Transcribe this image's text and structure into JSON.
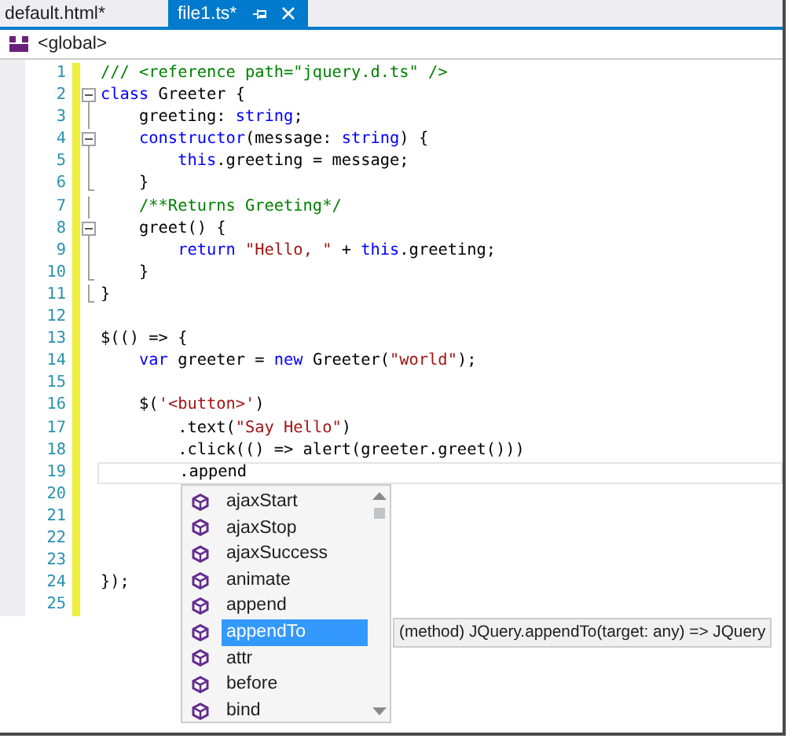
{
  "tabs": [
    {
      "label": "default.html*",
      "selected": false,
      "pinned": false
    },
    {
      "label": "file1.ts*",
      "selected": true,
      "pinned": true
    }
  ],
  "navigation_bar": {
    "scope": "<global>"
  },
  "editor": {
    "lines": [
      {
        "number": "1",
        "changed": true,
        "kind": "plain",
        "current": false,
        "tokens": [
          {
            "kind": "comment",
            "text": "/// <reference path=\"jquery.d.ts\" />"
          }
        ]
      },
      {
        "number": "2",
        "changed": true,
        "kind": "fold-start",
        "current": false,
        "tokens": [
          {
            "kind": "keyword",
            "text": "class"
          },
          {
            "kind": "plain",
            "text": " Greeter {"
          }
        ]
      },
      {
        "number": "3",
        "changed": true,
        "kind": "fold-inner",
        "current": false,
        "tokens": [
          {
            "kind": "plain",
            "text": "    greeting: "
          },
          {
            "kind": "keyword",
            "text": "string"
          },
          {
            "kind": "plain",
            "text": ";"
          }
        ]
      },
      {
        "number": "4",
        "changed": true,
        "kind": "fold-start",
        "current": false,
        "tokens": [
          {
            "kind": "keyword",
            "text": "    constructor"
          },
          {
            "kind": "plain",
            "text": "(message: "
          },
          {
            "kind": "keyword",
            "text": "string"
          },
          {
            "kind": "plain",
            "text": ") {"
          }
        ]
      },
      {
        "number": "5",
        "changed": true,
        "kind": "fold-inner",
        "current": false,
        "tokens": [
          {
            "kind": "keyword",
            "text": "        this"
          },
          {
            "kind": "plain",
            "text": ".greeting = message;"
          }
        ]
      },
      {
        "number": "6",
        "changed": true,
        "kind": "fold-end",
        "current": false,
        "tokens": [
          {
            "kind": "plain",
            "text": "    }"
          }
        ]
      },
      {
        "number": "7",
        "changed": true,
        "kind": "fold-inner",
        "current": false,
        "tokens": [
          {
            "kind": "comment",
            "text": "    /**Returns Greeting*/"
          }
        ]
      },
      {
        "number": "8",
        "changed": true,
        "kind": "fold-start",
        "current": false,
        "tokens": [
          {
            "kind": "plain",
            "text": "    greet() {"
          }
        ]
      },
      {
        "number": "9",
        "changed": true,
        "kind": "fold-inner",
        "current": false,
        "tokens": [
          {
            "kind": "keyword",
            "text": "        return "
          },
          {
            "kind": "string",
            "text": "\"Hello, \""
          },
          {
            "kind": "plain",
            "text": " + "
          },
          {
            "kind": "keyword",
            "text": "this"
          },
          {
            "kind": "plain",
            "text": ".greeting;"
          }
        ]
      },
      {
        "number": "10",
        "changed": true,
        "kind": "fold-end",
        "current": false,
        "tokens": [
          {
            "kind": "plain",
            "text": "    }"
          }
        ]
      },
      {
        "number": "11",
        "changed": true,
        "kind": "fold-end",
        "current": false,
        "tokens": [
          {
            "kind": "plain",
            "text": "}"
          }
        ]
      },
      {
        "number": "12",
        "changed": true,
        "kind": "plain",
        "current": false
      },
      {
        "number": "13",
        "changed": true,
        "kind": "plain",
        "current": false,
        "tokens": [
          {
            "kind": "plain",
            "text": "$(() => {"
          }
        ]
      },
      {
        "number": "14",
        "changed": true,
        "kind": "plain",
        "current": false,
        "tokens": [
          {
            "kind": "keyword",
            "text": "    var"
          },
          {
            "kind": "plain",
            "text": " greeter = "
          },
          {
            "kind": "keyword",
            "text": "new"
          },
          {
            "kind": "plain",
            "text": " Greeter("
          },
          {
            "kind": "string",
            "text": "\"world\""
          },
          {
            "kind": "plain",
            "text": ");"
          }
        ]
      },
      {
        "number": "15",
        "changed": true,
        "kind": "plain",
        "current": false
      },
      {
        "number": "16",
        "changed": true,
        "kind": "plain",
        "current": false,
        "tokens": [
          {
            "kind": "plain",
            "text": "    $("
          },
          {
            "kind": "string",
            "text": "'<button>'"
          },
          {
            "kind": "plain",
            "text": ")"
          }
        ]
      },
      {
        "number": "17",
        "changed": true,
        "kind": "plain",
        "current": false,
        "tokens": [
          {
            "kind": "plain",
            "text": "        .text("
          },
          {
            "kind": "string",
            "text": "\"Say Hello\""
          },
          {
            "kind": "plain",
            "text": ")"
          }
        ]
      },
      {
        "number": "18",
        "changed": true,
        "kind": "plain",
        "current": false,
        "tokens": [
          {
            "kind": "plain",
            "text": "        .click(() => alert(greeter.greet()))"
          }
        ]
      },
      {
        "number": "19",
        "changed": true,
        "kind": "plain",
        "current": true,
        "tokens": [
          {
            "kind": "plain",
            "text": "        .append"
          }
        ]
      },
      {
        "number": "20",
        "changed": true,
        "kind": "plain",
        "current": false
      },
      {
        "number": "21",
        "changed": true,
        "kind": "plain",
        "current": false
      },
      {
        "number": "22",
        "changed": true,
        "kind": "plain",
        "current": false
      },
      {
        "number": "23",
        "changed": true,
        "kind": "plain",
        "current": false
      },
      {
        "number": "24",
        "changed": true,
        "kind": "plain",
        "current": false,
        "tokens": [
          {
            "kind": "plain",
            "text": "});"
          }
        ]
      },
      {
        "number": "25",
        "changed": true,
        "kind": "plain",
        "current": false
      }
    ]
  },
  "completion_list": {
    "items": [
      {
        "label": "ajaxStart",
        "selected": false
      },
      {
        "label": "ajaxStop",
        "selected": false
      },
      {
        "label": "ajaxSuccess",
        "selected": false
      },
      {
        "label": "animate",
        "selected": false
      },
      {
        "label": "append",
        "selected": false
      },
      {
        "label": "appendTo",
        "selected": true
      },
      {
        "label": "attr",
        "selected": false
      },
      {
        "label": "before",
        "selected": false
      },
      {
        "label": "bind",
        "selected": false
      }
    ],
    "tooltip": "(method) JQuery.appendTo(target: any) => JQuery"
  }
}
